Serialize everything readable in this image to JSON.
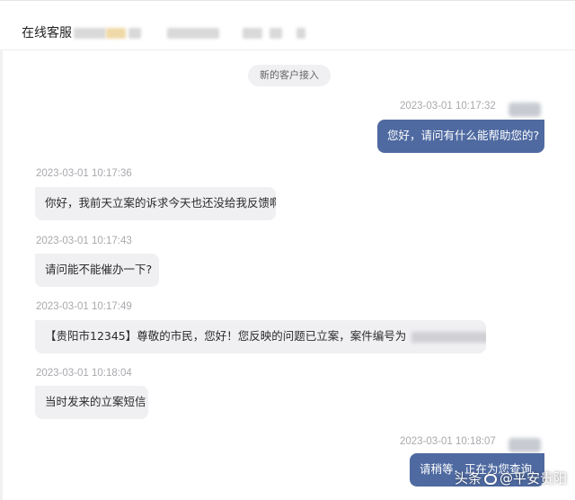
{
  "header": {
    "title": "在线客服"
  },
  "system_notice": "新的客户接入",
  "messages": [
    {
      "side": "out",
      "time": "2023-03-01 10:17:32",
      "text": "您好，请问有什么能帮助您的?"
    },
    {
      "side": "in",
      "time": "2023-03-01 10:17:36",
      "text": "你好，我前天立案的诉求今天也还没给我反馈啊"
    },
    {
      "side": "in",
      "time": "2023-03-01 10:17:43",
      "text": "请问能不能催办一下?"
    },
    {
      "side": "in",
      "time": "2023-03-01 10:17:49",
      "text": "【贵阳市12345】尊敬的市民，您好！您反映的问题已立案，案件编号为"
    },
    {
      "side": "in",
      "time": "2023-03-01 10:18:04",
      "text": "当时发来的立案短信"
    },
    {
      "side": "out",
      "time": "2023-03-01 10:18:07",
      "text": "请稍等，正在为您查询"
    }
  ],
  "watermark": {
    "prefix": "头条",
    "handle": "@平安贵阳"
  },
  "colors": {
    "outgoing_bubble": "#4f6aa1",
    "incoming_bubble": "#f0f0f3",
    "timestamp": "#a9a9ae"
  }
}
